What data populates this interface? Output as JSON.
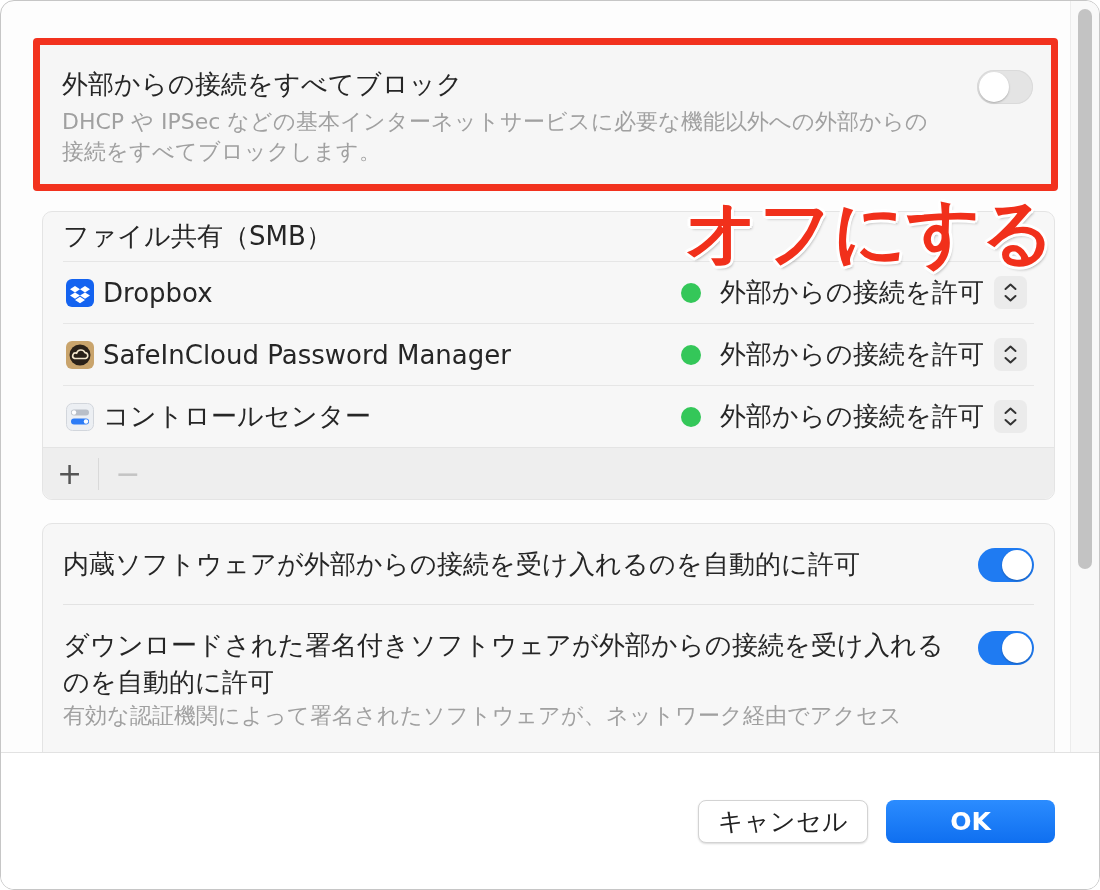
{
  "block_all": {
    "highlighted": true,
    "title": "外部からの接続をすべてブロック",
    "description": "DHCP や IPSec などの基本インターネットサービスに必要な機能以外への外部からの接続をすべてブロックします。",
    "on": false
  },
  "annotation": {
    "label": "オフにする"
  },
  "app_list": {
    "rows": [
      {
        "kind": "service",
        "name": "ファイル共有（SMB）"
      },
      {
        "kind": "app",
        "name": "Dropbox",
        "status": "外部からの接続を許可",
        "color": "#34c759"
      },
      {
        "kind": "app",
        "name": "SafeInCloud Password Manager",
        "status": "外部からの接続を許可",
        "color": "#34c759"
      },
      {
        "kind": "app",
        "name": "コントロールセンター",
        "status": "外部からの接続を許可",
        "color": "#34c759"
      }
    ],
    "add_button": {
      "label": "+",
      "disabled": false
    },
    "remove_button": {
      "label": "−",
      "disabled": true
    }
  },
  "auto_allow": {
    "items": [
      {
        "label": "内蔵ソフトウェアが外部からの接続を受け入れるのを自動的に許可",
        "on": true
      },
      {
        "label": "ダウンロードされた署名付きソフトウェアが外部からの接続を受け入れるのを自動的に許可",
        "description": "有効な認証機関によって署名されたソフトウェアが、ネットワーク経由でアクセス",
        "on": true
      }
    ]
  },
  "buttons": [
    {
      "label": "キャンセル",
      "kind": "secondary"
    },
    {
      "label": "OK",
      "kind": "primary"
    }
  ]
}
